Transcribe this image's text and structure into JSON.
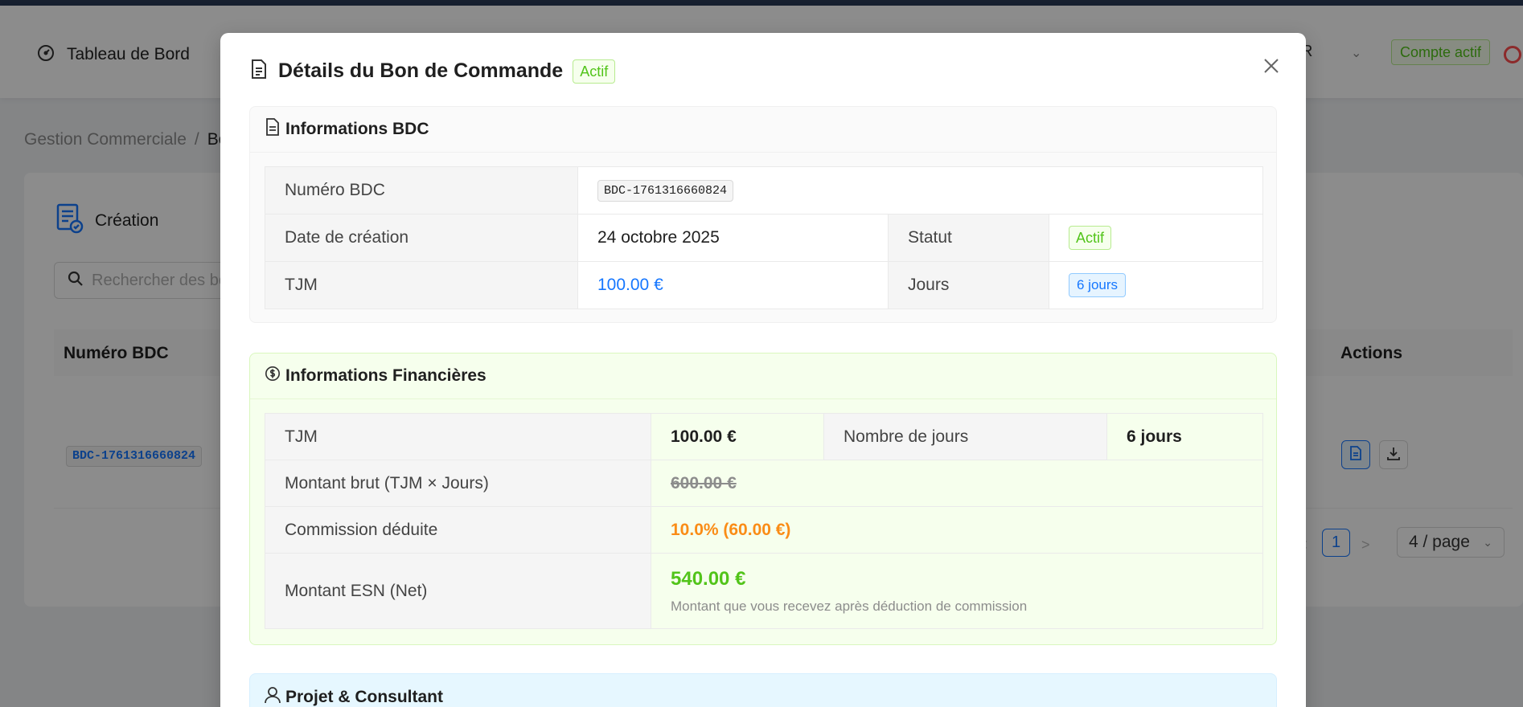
{
  "header": {
    "dashboard_label": "Tableau de Bord",
    "user_initial": "R",
    "account_status": "Compte actif"
  },
  "breadcrumb": {
    "items": [
      "Gestion Commerciale",
      "Bo"
    ]
  },
  "card": {
    "title": "Création",
    "search_placeholder": "Rechercher des bons de commande",
    "columns": {
      "number": "Numéro BDC",
      "actions": "Actions"
    },
    "rows": [
      {
        "number": "BDC-1761316660824"
      }
    ],
    "pagination": {
      "page": "1",
      "page_size": "4 / page"
    }
  },
  "modal": {
    "title": "Détails du Bon de Commande",
    "status_tag": "Actif",
    "bdc_section": {
      "title": "Informations BDC",
      "number_label": "Numéro BDC",
      "number_value": "BDC-1761316660824",
      "date_label": "Date de création",
      "date_value": "24 octobre 2025",
      "status_label": "Statut",
      "status_value": "Actif",
      "tjm_label": "TJM",
      "tjm_value": "100.00 €",
      "days_label": "Jours",
      "days_value": "6 jours"
    },
    "finance_section": {
      "title": "Informations Financières",
      "tjm_label": "TJM",
      "tjm_value": "100.00 €",
      "days_label": "Nombre de jours",
      "days_value": "6 jours",
      "gross_label": "Montant brut (TJM × Jours)",
      "gross_value": "600.00 €",
      "commission_label": "Commission déduite",
      "commission_value": "10.0% (60.00 €)",
      "net_label": "Montant ESN (Net)",
      "net_value": "540.00 €",
      "net_note": "Montant que vous recevez après déduction de commission"
    },
    "project_section": {
      "title": "Projet & Consultant"
    }
  },
  "colors": {
    "primary": "#1677ff",
    "success": "#52c41a",
    "warning": "#fa8c16",
    "danger": "#ff4d4f"
  }
}
